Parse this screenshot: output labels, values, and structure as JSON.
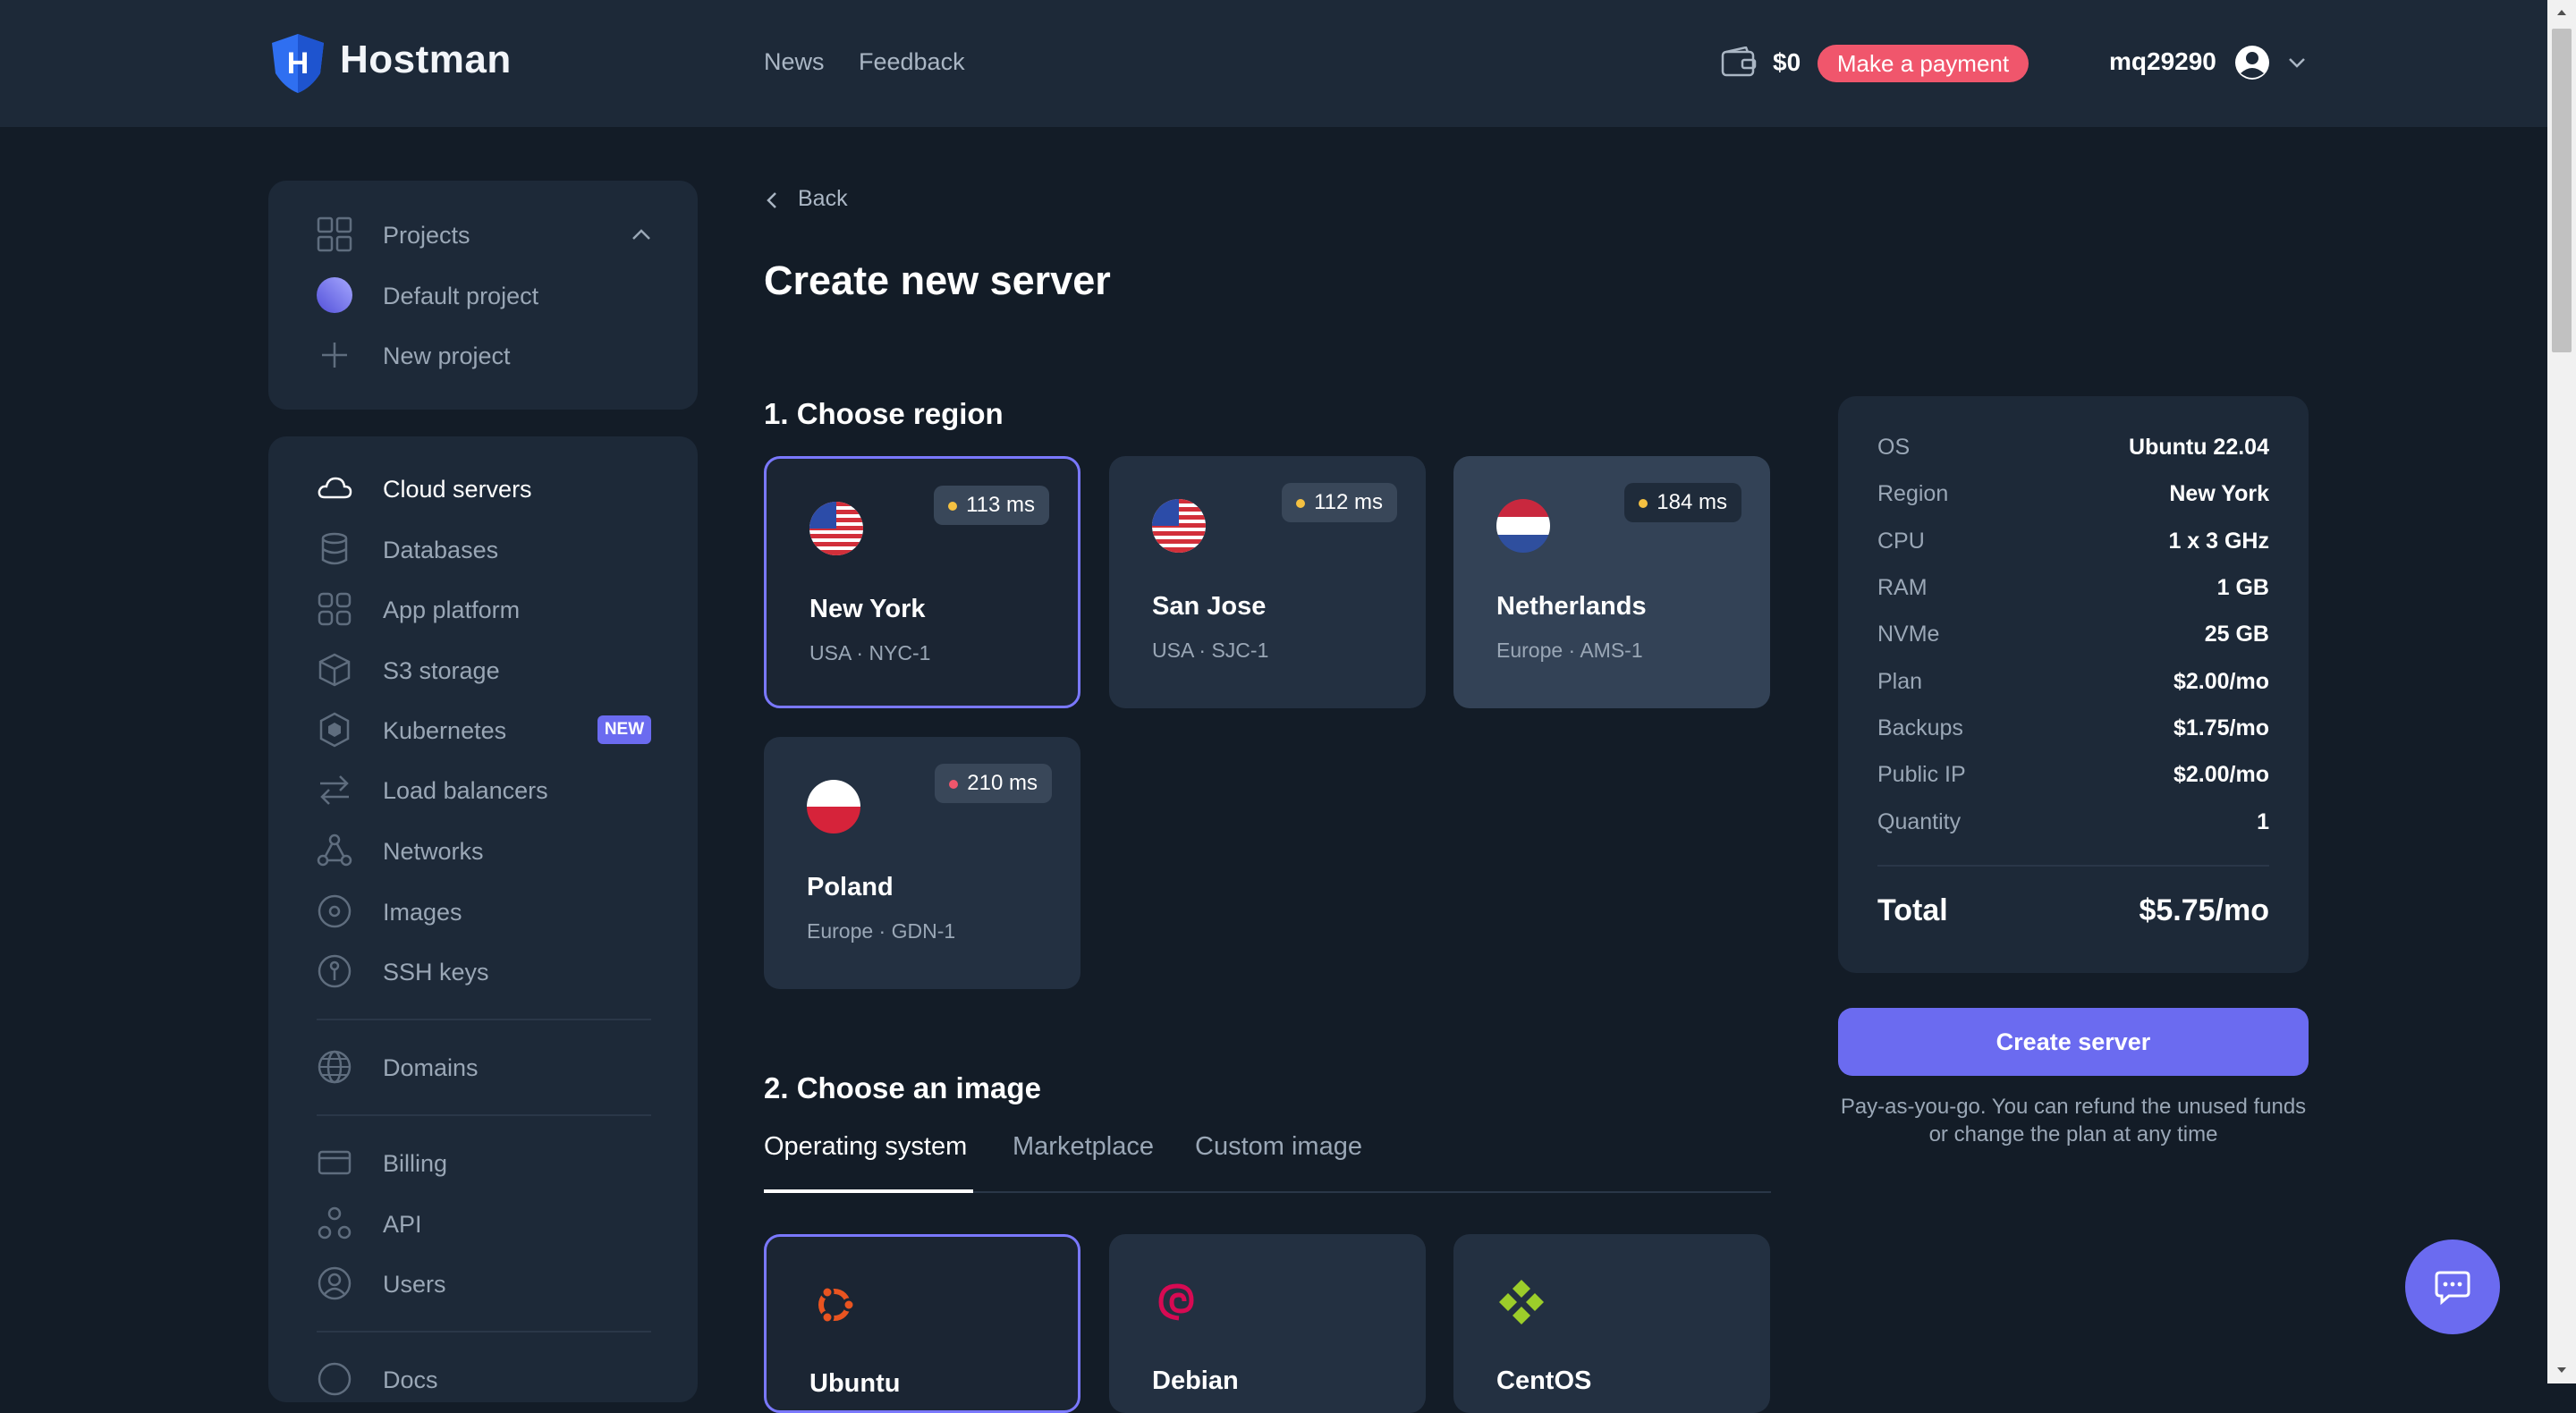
{
  "header": {
    "brand": "Hostman",
    "nav": [
      "News",
      "Feedback"
    ],
    "balance": "$0",
    "pay_button": "Make a payment",
    "username": "mq29290"
  },
  "sidebar": {
    "projects": {
      "title": "Projects",
      "items": [
        "Default project",
        "New project"
      ]
    },
    "items": [
      {
        "label": "Cloud servers",
        "icon": "cloud-icon"
      },
      {
        "label": "Databases",
        "icon": "database-icon"
      },
      {
        "label": "App platform",
        "icon": "app-grid-icon"
      },
      {
        "label": "S3 storage",
        "icon": "cube-icon"
      },
      {
        "label": "Kubernetes",
        "icon": "kubernetes-icon",
        "badge": "NEW"
      },
      {
        "label": "Load balancers",
        "icon": "arrows-icon"
      },
      {
        "label": "Networks",
        "icon": "network-icon"
      },
      {
        "label": "Images",
        "icon": "disc-icon"
      },
      {
        "label": "SSH keys",
        "icon": "key-icon"
      },
      {
        "label": "Domains",
        "icon": "globe-icon"
      },
      {
        "label": "Billing",
        "icon": "card-icon"
      },
      {
        "label": "API",
        "icon": "api-icon"
      },
      {
        "label": "Users",
        "icon": "user-icon"
      },
      {
        "label": "Docs",
        "icon": "help-icon"
      }
    ]
  },
  "main": {
    "back": "Back",
    "title": "Create new server",
    "section1": "1. Choose region",
    "regions": [
      {
        "name": "New York",
        "sub": "USA · NYC-1",
        "ping": "113 ms",
        "ping_color": "#f5c141",
        "flag": "us"
      },
      {
        "name": "San Jose",
        "sub": "USA · SJC-1",
        "ping": "112 ms",
        "ping_color": "#f5c141",
        "flag": "us"
      },
      {
        "name": "Netherlands",
        "sub": "Europe · AMS-1",
        "ping": "184 ms",
        "ping_color": "#f5c141",
        "flag": "nl"
      },
      {
        "name": "Poland",
        "sub": "Europe · GDN-1",
        "ping": "210 ms",
        "ping_color": "#f0566c",
        "flag": "pl"
      }
    ],
    "section2": "2. Choose an image",
    "tabs": [
      "Operating system",
      "Marketplace",
      "Custom image"
    ],
    "os": [
      {
        "name": "Ubuntu",
        "icon": "ubuntu-icon"
      },
      {
        "name": "Debian",
        "icon": "debian-icon"
      },
      {
        "name": "CentOS",
        "icon": "centos-icon"
      }
    ]
  },
  "summary": {
    "rows": [
      {
        "k": "OS",
        "v": "Ubuntu 22.04"
      },
      {
        "k": "Region",
        "v": "New York"
      },
      {
        "k": "CPU",
        "v": "1 x 3 GHz"
      },
      {
        "k": "RAM",
        "v": "1 GB"
      },
      {
        "k": "NVMe",
        "v": "25 GB"
      },
      {
        "k": "Plan",
        "v": "$2.00/mo"
      },
      {
        "k": "Backups",
        "v": "$1.75/mo"
      },
      {
        "k": "Public IP",
        "v": "$2.00/mo"
      },
      {
        "k": "Quantity",
        "v": "1"
      }
    ],
    "total_label": "Total",
    "total_value": "$5.75/mo",
    "create_button": "Create server",
    "note": "Pay-as-you-go. You can refund the unused funds or change the plan at any time"
  },
  "colors": {
    "accent": "#6b6bf0",
    "selected_border": "#7a78ff",
    "pay": "#f0566c"
  }
}
